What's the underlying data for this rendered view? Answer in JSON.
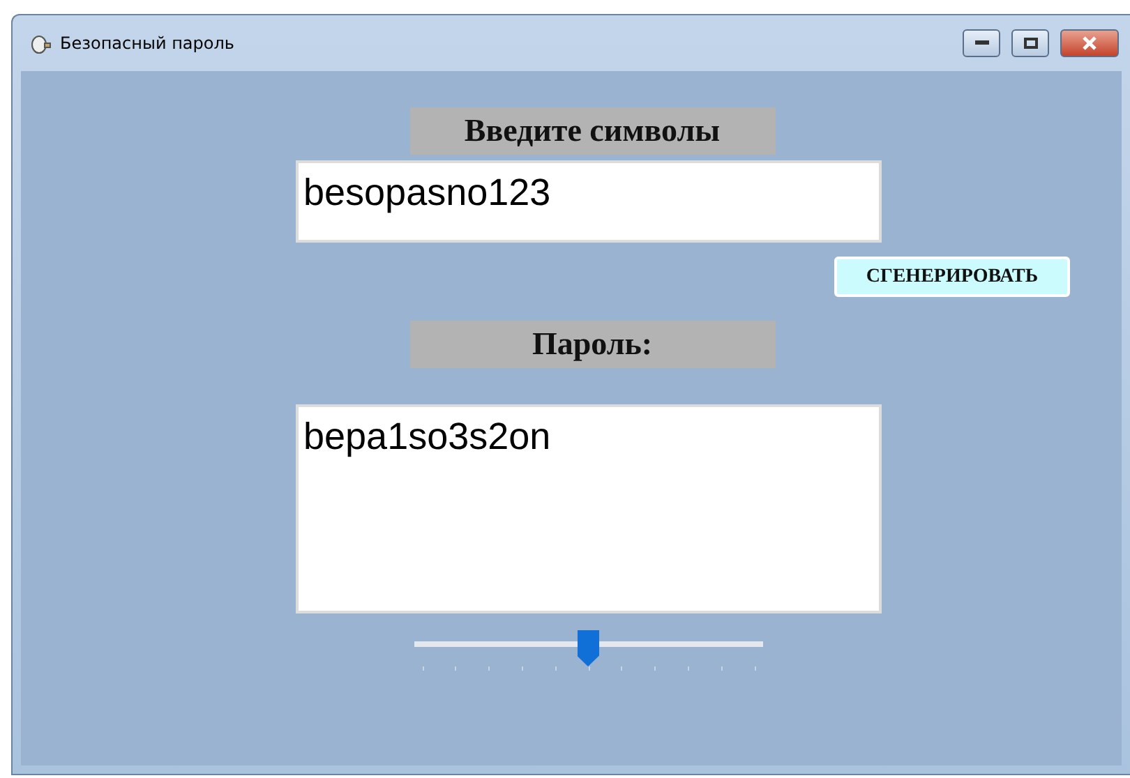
{
  "window": {
    "title": "Безопасный пароль"
  },
  "input_label": "Введите символы",
  "input_value": "besopasno123",
  "generate_button": "СГЕНЕРИРОВАТЬ",
  "output_label": "Пароль:",
  "output_value": "bepa1so3s2on",
  "length_slider": {
    "level": 0.5
  }
}
